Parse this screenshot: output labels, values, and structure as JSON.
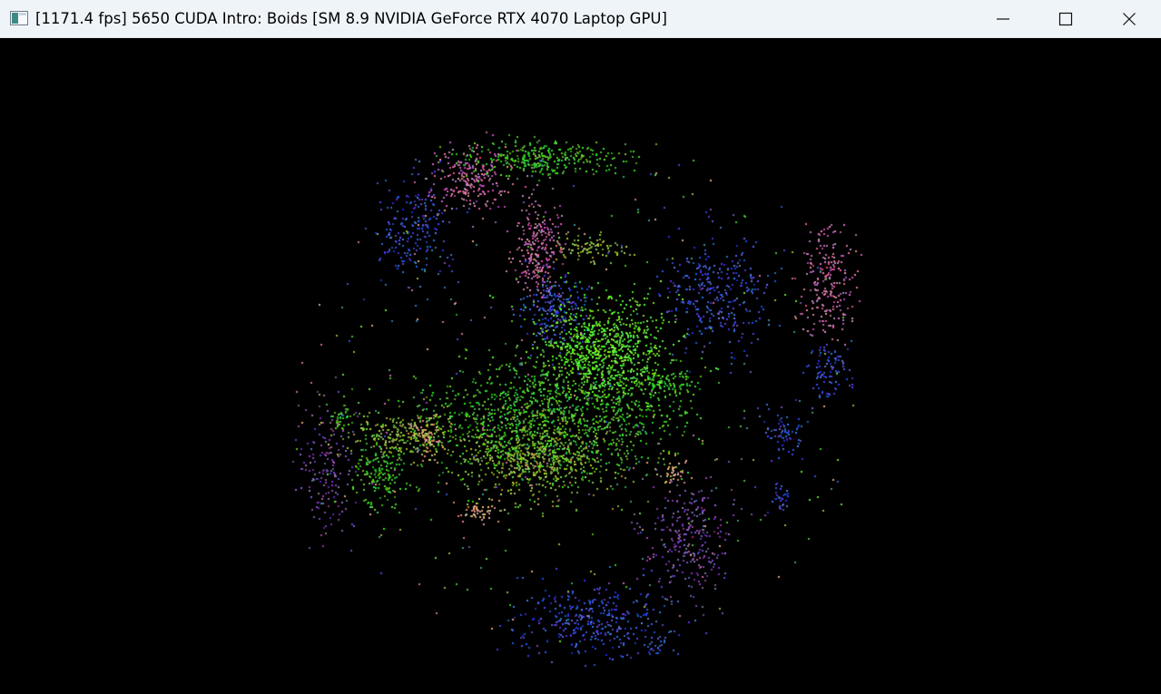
{
  "window": {
    "title": "[1171.4 fps] 5650 CUDA Intro: Boids [SM 8.9 NVIDIA GeForce RTX 4070 Laptop GPU]",
    "app_icon": "app-window-icon",
    "controls": {
      "minimize": "minimize-icon",
      "maximize": "maximize-icon",
      "close": "close-icon"
    }
  },
  "scene": {
    "background": "#000000",
    "boid_count": 5650,
    "fps": "1171.4",
    "palette": {
      "green": "#3fbf2a",
      "bright_green": "#5fe12e",
      "blue": "#3a4fd0",
      "purple": "#7a4aa8",
      "pink": "#c46aa0",
      "olive": "#8fb03a",
      "peach": "#d9a07a",
      "teal": "#3b8f8a"
    }
  }
}
